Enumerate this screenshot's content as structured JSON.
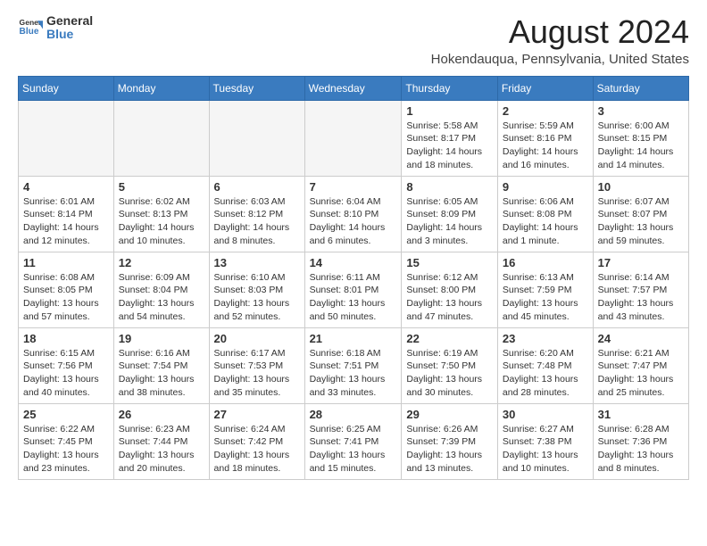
{
  "header": {
    "logo_general": "General",
    "logo_blue": "Blue",
    "month_year": "August 2024",
    "location": "Hokendauqua, Pennsylvania, United States"
  },
  "weekdays": [
    "Sunday",
    "Monday",
    "Tuesday",
    "Wednesday",
    "Thursday",
    "Friday",
    "Saturday"
  ],
  "weeks": [
    [
      {
        "day": "",
        "empty": true
      },
      {
        "day": "",
        "empty": true
      },
      {
        "day": "",
        "empty": true
      },
      {
        "day": "",
        "empty": true
      },
      {
        "day": "1",
        "sunrise": "5:58 AM",
        "sunset": "8:17 PM",
        "daylight": "14 hours and 18 minutes."
      },
      {
        "day": "2",
        "sunrise": "5:59 AM",
        "sunset": "8:16 PM",
        "daylight": "14 hours and 16 minutes."
      },
      {
        "day": "3",
        "sunrise": "6:00 AM",
        "sunset": "8:15 PM",
        "daylight": "14 hours and 14 minutes."
      }
    ],
    [
      {
        "day": "4",
        "sunrise": "6:01 AM",
        "sunset": "8:14 PM",
        "daylight": "14 hours and 12 minutes."
      },
      {
        "day": "5",
        "sunrise": "6:02 AM",
        "sunset": "8:13 PM",
        "daylight": "14 hours and 10 minutes."
      },
      {
        "day": "6",
        "sunrise": "6:03 AM",
        "sunset": "8:12 PM",
        "daylight": "14 hours and 8 minutes."
      },
      {
        "day": "7",
        "sunrise": "6:04 AM",
        "sunset": "8:10 PM",
        "daylight": "14 hours and 6 minutes."
      },
      {
        "day": "8",
        "sunrise": "6:05 AM",
        "sunset": "8:09 PM",
        "daylight": "14 hours and 3 minutes."
      },
      {
        "day": "9",
        "sunrise": "6:06 AM",
        "sunset": "8:08 PM",
        "daylight": "14 hours and 1 minute."
      },
      {
        "day": "10",
        "sunrise": "6:07 AM",
        "sunset": "8:07 PM",
        "daylight": "13 hours and 59 minutes."
      }
    ],
    [
      {
        "day": "11",
        "sunrise": "6:08 AM",
        "sunset": "8:05 PM",
        "daylight": "13 hours and 57 minutes."
      },
      {
        "day": "12",
        "sunrise": "6:09 AM",
        "sunset": "8:04 PM",
        "daylight": "13 hours and 54 minutes."
      },
      {
        "day": "13",
        "sunrise": "6:10 AM",
        "sunset": "8:03 PM",
        "daylight": "13 hours and 52 minutes."
      },
      {
        "day": "14",
        "sunrise": "6:11 AM",
        "sunset": "8:01 PM",
        "daylight": "13 hours and 50 minutes."
      },
      {
        "day": "15",
        "sunrise": "6:12 AM",
        "sunset": "8:00 PM",
        "daylight": "13 hours and 47 minutes."
      },
      {
        "day": "16",
        "sunrise": "6:13 AM",
        "sunset": "7:59 PM",
        "daylight": "13 hours and 45 minutes."
      },
      {
        "day": "17",
        "sunrise": "6:14 AM",
        "sunset": "7:57 PM",
        "daylight": "13 hours and 43 minutes."
      }
    ],
    [
      {
        "day": "18",
        "sunrise": "6:15 AM",
        "sunset": "7:56 PM",
        "daylight": "13 hours and 40 minutes."
      },
      {
        "day": "19",
        "sunrise": "6:16 AM",
        "sunset": "7:54 PM",
        "daylight": "13 hours and 38 minutes."
      },
      {
        "day": "20",
        "sunrise": "6:17 AM",
        "sunset": "7:53 PM",
        "daylight": "13 hours and 35 minutes."
      },
      {
        "day": "21",
        "sunrise": "6:18 AM",
        "sunset": "7:51 PM",
        "daylight": "13 hours and 33 minutes."
      },
      {
        "day": "22",
        "sunrise": "6:19 AM",
        "sunset": "7:50 PM",
        "daylight": "13 hours and 30 minutes."
      },
      {
        "day": "23",
        "sunrise": "6:20 AM",
        "sunset": "7:48 PM",
        "daylight": "13 hours and 28 minutes."
      },
      {
        "day": "24",
        "sunrise": "6:21 AM",
        "sunset": "7:47 PM",
        "daylight": "13 hours and 25 minutes."
      }
    ],
    [
      {
        "day": "25",
        "sunrise": "6:22 AM",
        "sunset": "7:45 PM",
        "daylight": "13 hours and 23 minutes."
      },
      {
        "day": "26",
        "sunrise": "6:23 AM",
        "sunset": "7:44 PM",
        "daylight": "13 hours and 20 minutes."
      },
      {
        "day": "27",
        "sunrise": "6:24 AM",
        "sunset": "7:42 PM",
        "daylight": "13 hours and 18 minutes."
      },
      {
        "day": "28",
        "sunrise": "6:25 AM",
        "sunset": "7:41 PM",
        "daylight": "13 hours and 15 minutes."
      },
      {
        "day": "29",
        "sunrise": "6:26 AM",
        "sunset": "7:39 PM",
        "daylight": "13 hours and 13 minutes."
      },
      {
        "day": "30",
        "sunrise": "6:27 AM",
        "sunset": "7:38 PM",
        "daylight": "13 hours and 10 minutes."
      },
      {
        "day": "31",
        "sunrise": "6:28 AM",
        "sunset": "7:36 PM",
        "daylight": "13 hours and 8 minutes."
      }
    ]
  ]
}
